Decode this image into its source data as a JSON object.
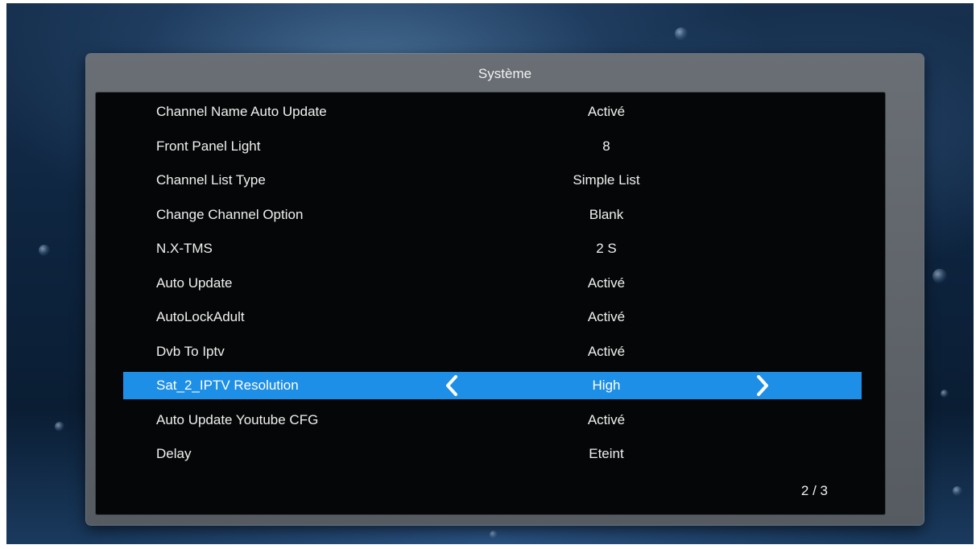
{
  "panel": {
    "title": "Système"
  },
  "menu": {
    "items": [
      {
        "label": "Channel Name Auto Update",
        "value": "Activé"
      },
      {
        "label": "Front Panel Light",
        "value": "8"
      },
      {
        "label": "Channel List Type",
        "value": "Simple List"
      },
      {
        "label": "Change Channel Option",
        "value": "Blank"
      },
      {
        "label": "N.X-TMS",
        "value": "2 S"
      },
      {
        "label": "Auto Update",
        "value": "Activé"
      },
      {
        "label": "AutoLockAdult",
        "value": "Activé"
      },
      {
        "label": "Dvb To Iptv",
        "value": "Activé"
      },
      {
        "label": "Sat_2_IPTV Resolution",
        "value": "High",
        "selected": true
      },
      {
        "label": "Auto Update Youtube CFG",
        "value": "Activé"
      },
      {
        "label": "Delay",
        "value": "Eteint"
      }
    ]
  },
  "pagination": {
    "text": "2 / 3"
  },
  "colors": {
    "highlight": "#1e8fe6",
    "panel_frame": "#5f646a",
    "panel_inner": "#050607",
    "text": "#f0f0f0"
  },
  "icons": {
    "left_arrow": "chevron-left-icon",
    "right_arrow": "chevron-right-icon"
  }
}
